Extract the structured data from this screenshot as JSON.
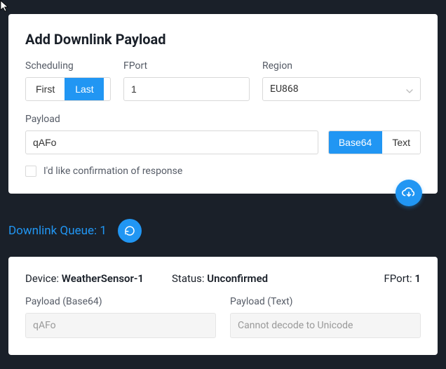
{
  "addPanel": {
    "title": "Add Downlink Payload",
    "scheduling": {
      "label": "Scheduling",
      "options": [
        "First",
        "Last"
      ],
      "selected": "Last"
    },
    "fport": {
      "label": "FPort",
      "value": "1"
    },
    "region": {
      "label": "Region",
      "value": "EU868"
    },
    "payload": {
      "label": "Payload",
      "value": "qAFo",
      "encoding_options": [
        "Base64",
        "Text"
      ],
      "encoding_selected": "Base64"
    },
    "confirm": {
      "label": "I'd like confirmation of response",
      "checked": false
    }
  },
  "queue": {
    "label_prefix": "Downlink Queue: ",
    "count": "1"
  },
  "deviceCard": {
    "device_label": "Device: ",
    "device_value": "WeatherSensor-1",
    "status_label": "Status: ",
    "status_value": "Unconfirmed",
    "fport_label": "FPort: ",
    "fport_value": "1",
    "payload_b64": {
      "label": "Payload (Base64)",
      "value": "qAFo"
    },
    "payload_text": {
      "label": "Payload (Text)",
      "value": "Cannot decode to Unicode"
    }
  }
}
